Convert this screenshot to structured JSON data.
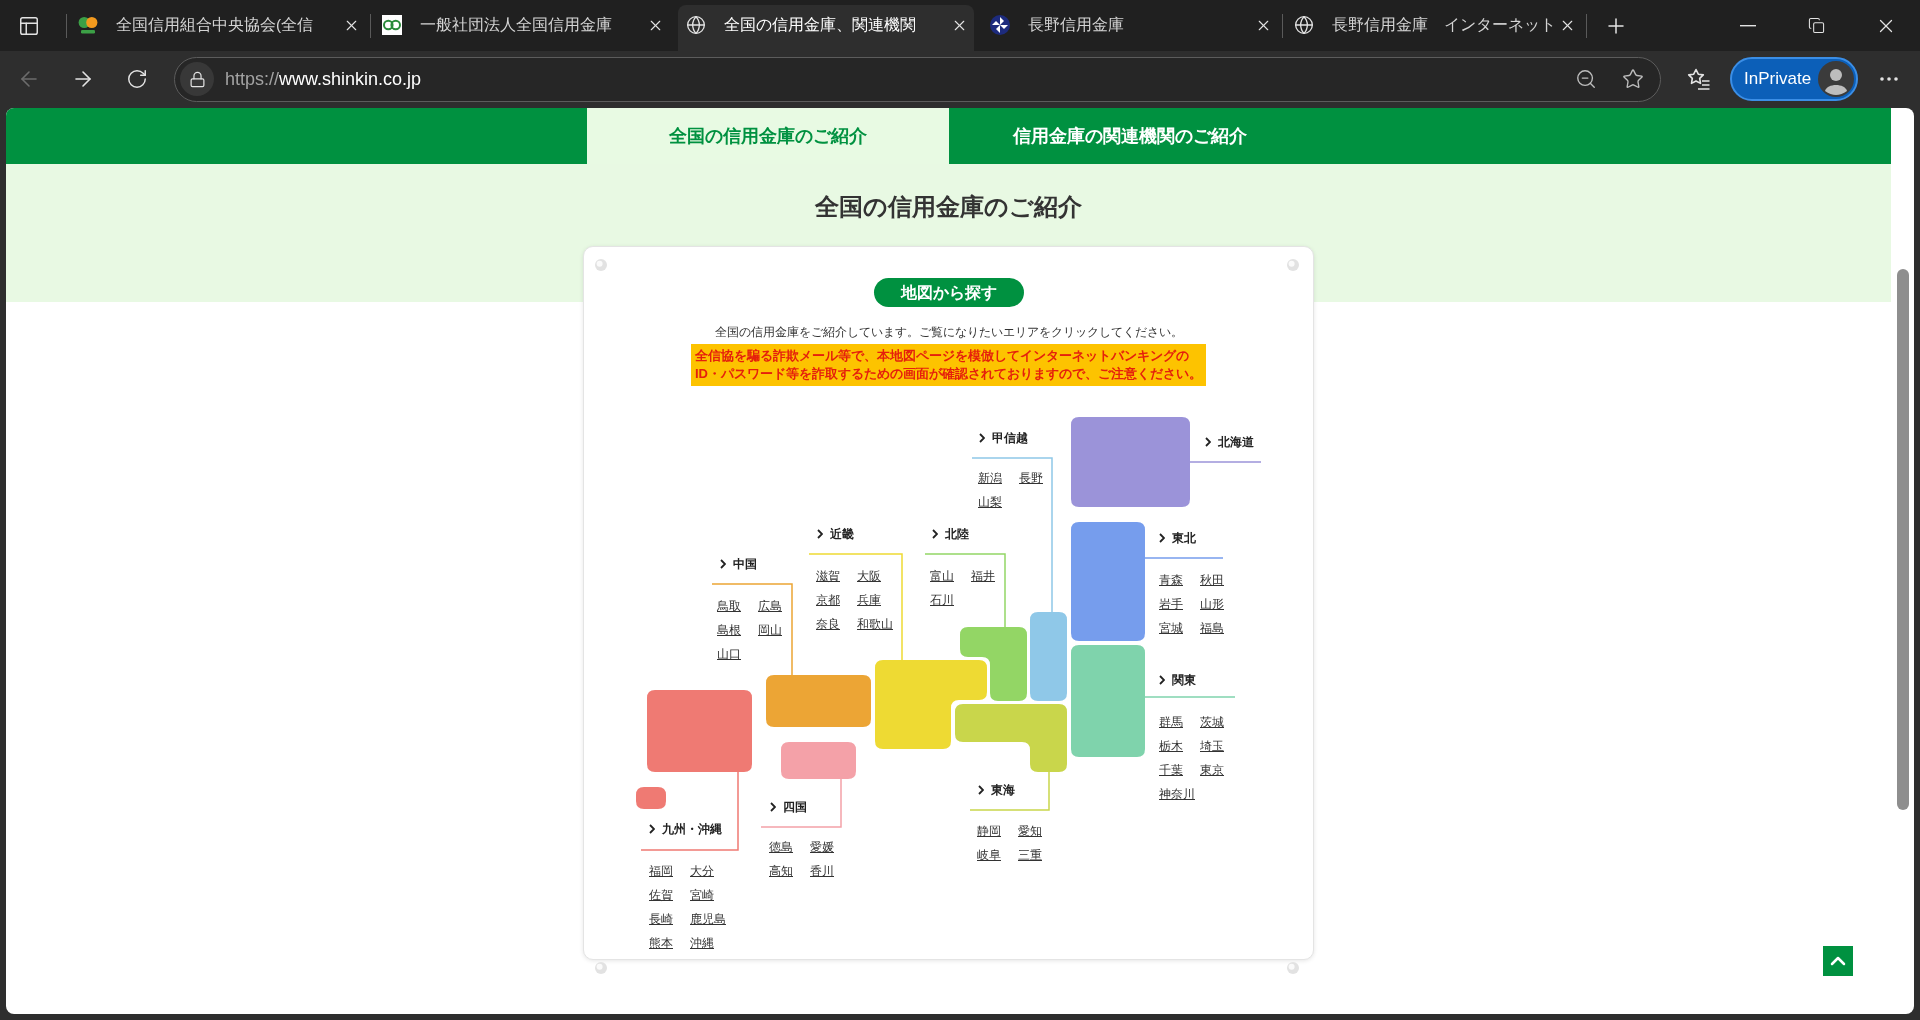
{
  "browser": {
    "tabs": [
      {
        "title": "全国信用組合中央協会(全信",
        "kind": "twin-dots",
        "selected": false
      },
      {
        "title": "一般社団法人全国信用金庫",
        "kind": "two-rings",
        "selected": false
      },
      {
        "title": "全国の信用金庫、関連機関",
        "kind": "globe",
        "selected": true
      },
      {
        "title": "長野信用金庫",
        "kind": "pinwheel",
        "selected": false
      },
      {
        "title": "長野信用金庫　インターネット",
        "kind": "globe",
        "selected": false
      }
    ],
    "nav_buttons": [
      {
        "kind": "back",
        "disabled": true
      },
      {
        "kind": "forward",
        "disabled": false
      },
      {
        "kind": "refresh",
        "disabled": false
      }
    ],
    "address": {
      "scheme": "https://",
      "host": "www.shinkin.co.jp"
    },
    "profile": {
      "label": "InPrivate"
    }
  },
  "page": {
    "tabs": [
      {
        "label": "全国の信用金庫のご紹介",
        "selected": true
      },
      {
        "label": "信用金庫の関連機関のご紹介",
        "selected": false
      }
    ],
    "title": "全国の信用金庫のご紹介",
    "card": {
      "heading": "地図から探す",
      "intro": "全国の信用金庫をご紹介しています。ご覧になりたいエリアをクリックしてください。",
      "warning": "全信協を騙る詐欺メール等で、本地図ページを模倣してインターネットバンキングの\nID・パスワード等を詐取するための画面が確認されておりますので、ご注意ください。"
    },
    "map": {
      "regions": [
        {
          "name": "北海道",
          "color": "#9b93d9"
        },
        {
          "name": "東北",
          "color": "#769ded",
          "prefectures": [
            "青森",
            "秋田",
            "岩手",
            "山形",
            "宮城",
            "福島"
          ]
        },
        {
          "name": "関東",
          "color": "#7fd3ac",
          "prefectures": [
            "群馬",
            "茨城",
            "栃木",
            "埼玉",
            "千葉",
            "東京",
            "神奈川"
          ]
        },
        {
          "name": "甲信越",
          "color": "#8fc8e8",
          "prefectures": [
            "新潟",
            "長野",
            "山梨"
          ]
        },
        {
          "name": "北陸",
          "color": "#93d665",
          "prefectures": [
            "富山",
            "福井",
            "石川"
          ]
        },
        {
          "name": "東海",
          "color": "#c9d64b",
          "prefectures": [
            "静岡",
            "愛知",
            "岐阜",
            "三重"
          ]
        },
        {
          "name": "近畿",
          "color": "#eeda33",
          "prefectures": [
            "滋賀",
            "大阪",
            "京都",
            "兵庫",
            "奈良",
            "和歌山"
          ]
        },
        {
          "name": "中国",
          "color": "#eca535",
          "prefectures": [
            "鳥取",
            "広島",
            "島根",
            "岡山",
            "山口"
          ]
        },
        {
          "name": "四国",
          "color": "#f4a1a8",
          "prefectures": [
            "徳島",
            "愛媛",
            "高知",
            "香川"
          ]
        },
        {
          "name": "九州・沖縄",
          "color": "#ef7a73",
          "prefectures": [
            "福岡",
            "大分",
            "佐賀",
            "宮崎",
            "長崎",
            "鹿児島",
            "熊本",
            "沖縄"
          ]
        }
      ]
    }
  }
}
